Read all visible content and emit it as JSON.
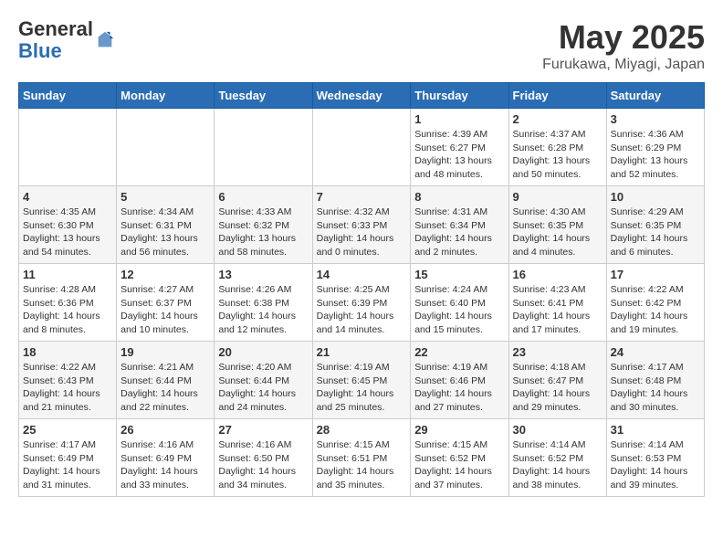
{
  "logo": {
    "general": "General",
    "blue": "Blue"
  },
  "header": {
    "month_year": "May 2025",
    "location": "Furukawa, Miyagi, Japan"
  },
  "weekdays": [
    "Sunday",
    "Monday",
    "Tuesday",
    "Wednesday",
    "Thursday",
    "Friday",
    "Saturday"
  ],
  "weeks": [
    [
      {
        "day": "",
        "info": ""
      },
      {
        "day": "",
        "info": ""
      },
      {
        "day": "",
        "info": ""
      },
      {
        "day": "",
        "info": ""
      },
      {
        "day": "1",
        "info": "Sunrise: 4:39 AM\nSunset: 6:27 PM\nDaylight: 13 hours\nand 48 minutes."
      },
      {
        "day": "2",
        "info": "Sunrise: 4:37 AM\nSunset: 6:28 PM\nDaylight: 13 hours\nand 50 minutes."
      },
      {
        "day": "3",
        "info": "Sunrise: 4:36 AM\nSunset: 6:29 PM\nDaylight: 13 hours\nand 52 minutes."
      }
    ],
    [
      {
        "day": "4",
        "info": "Sunrise: 4:35 AM\nSunset: 6:30 PM\nDaylight: 13 hours\nand 54 minutes."
      },
      {
        "day": "5",
        "info": "Sunrise: 4:34 AM\nSunset: 6:31 PM\nDaylight: 13 hours\nand 56 minutes."
      },
      {
        "day": "6",
        "info": "Sunrise: 4:33 AM\nSunset: 6:32 PM\nDaylight: 13 hours\nand 58 minutes."
      },
      {
        "day": "7",
        "info": "Sunrise: 4:32 AM\nSunset: 6:33 PM\nDaylight: 14 hours\nand 0 minutes."
      },
      {
        "day": "8",
        "info": "Sunrise: 4:31 AM\nSunset: 6:34 PM\nDaylight: 14 hours\nand 2 minutes."
      },
      {
        "day": "9",
        "info": "Sunrise: 4:30 AM\nSunset: 6:35 PM\nDaylight: 14 hours\nand 4 minutes."
      },
      {
        "day": "10",
        "info": "Sunrise: 4:29 AM\nSunset: 6:35 PM\nDaylight: 14 hours\nand 6 minutes."
      }
    ],
    [
      {
        "day": "11",
        "info": "Sunrise: 4:28 AM\nSunset: 6:36 PM\nDaylight: 14 hours\nand 8 minutes."
      },
      {
        "day": "12",
        "info": "Sunrise: 4:27 AM\nSunset: 6:37 PM\nDaylight: 14 hours\nand 10 minutes."
      },
      {
        "day": "13",
        "info": "Sunrise: 4:26 AM\nSunset: 6:38 PM\nDaylight: 14 hours\nand 12 minutes."
      },
      {
        "day": "14",
        "info": "Sunrise: 4:25 AM\nSunset: 6:39 PM\nDaylight: 14 hours\nand 14 minutes."
      },
      {
        "day": "15",
        "info": "Sunrise: 4:24 AM\nSunset: 6:40 PM\nDaylight: 14 hours\nand 15 minutes."
      },
      {
        "day": "16",
        "info": "Sunrise: 4:23 AM\nSunset: 6:41 PM\nDaylight: 14 hours\nand 17 minutes."
      },
      {
        "day": "17",
        "info": "Sunrise: 4:22 AM\nSunset: 6:42 PM\nDaylight: 14 hours\nand 19 minutes."
      }
    ],
    [
      {
        "day": "18",
        "info": "Sunrise: 4:22 AM\nSunset: 6:43 PM\nDaylight: 14 hours\nand 21 minutes."
      },
      {
        "day": "19",
        "info": "Sunrise: 4:21 AM\nSunset: 6:44 PM\nDaylight: 14 hours\nand 22 minutes."
      },
      {
        "day": "20",
        "info": "Sunrise: 4:20 AM\nSunset: 6:44 PM\nDaylight: 14 hours\nand 24 minutes."
      },
      {
        "day": "21",
        "info": "Sunrise: 4:19 AM\nSunset: 6:45 PM\nDaylight: 14 hours\nand 25 minutes."
      },
      {
        "day": "22",
        "info": "Sunrise: 4:19 AM\nSunset: 6:46 PM\nDaylight: 14 hours\nand 27 minutes."
      },
      {
        "day": "23",
        "info": "Sunrise: 4:18 AM\nSunset: 6:47 PM\nDaylight: 14 hours\nand 29 minutes."
      },
      {
        "day": "24",
        "info": "Sunrise: 4:17 AM\nSunset: 6:48 PM\nDaylight: 14 hours\nand 30 minutes."
      }
    ],
    [
      {
        "day": "25",
        "info": "Sunrise: 4:17 AM\nSunset: 6:49 PM\nDaylight: 14 hours\nand 31 minutes."
      },
      {
        "day": "26",
        "info": "Sunrise: 4:16 AM\nSunset: 6:49 PM\nDaylight: 14 hours\nand 33 minutes."
      },
      {
        "day": "27",
        "info": "Sunrise: 4:16 AM\nSunset: 6:50 PM\nDaylight: 14 hours\nand 34 minutes."
      },
      {
        "day": "28",
        "info": "Sunrise: 4:15 AM\nSunset: 6:51 PM\nDaylight: 14 hours\nand 35 minutes."
      },
      {
        "day": "29",
        "info": "Sunrise: 4:15 AM\nSunset: 6:52 PM\nDaylight: 14 hours\nand 37 minutes."
      },
      {
        "day": "30",
        "info": "Sunrise: 4:14 AM\nSunset: 6:52 PM\nDaylight: 14 hours\nand 38 minutes."
      },
      {
        "day": "31",
        "info": "Sunrise: 4:14 AM\nSunset: 6:53 PM\nDaylight: 14 hours\nand 39 minutes."
      }
    ]
  ]
}
